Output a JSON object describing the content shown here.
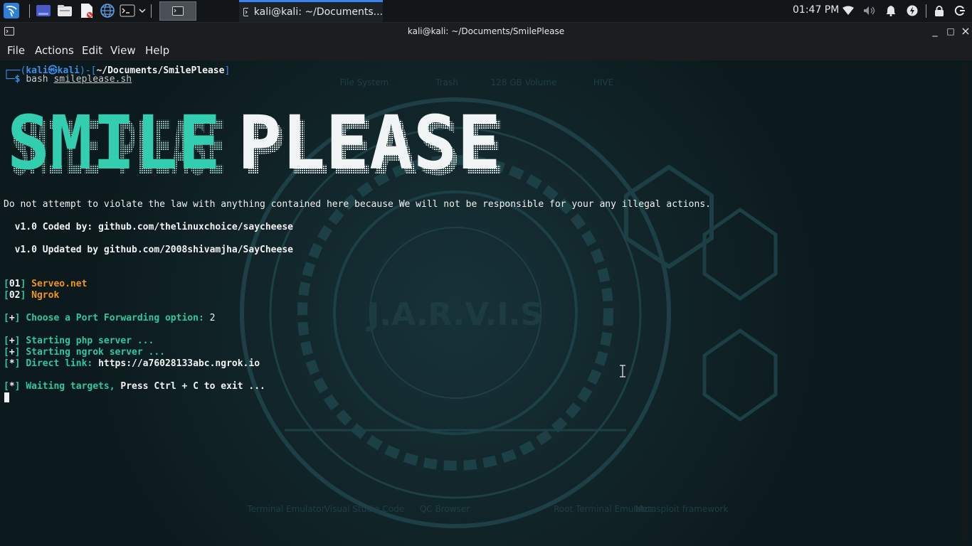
{
  "panel": {
    "clock": "01:47 PM",
    "task_title": "kali@kali: ~/Documents...",
    "launchers": [
      "show-desktop-icon",
      "file-manager-icon",
      "text-editor-icon",
      "web-browser-icon",
      "terminal-icon"
    ]
  },
  "window": {
    "title": "kali@kali: ~/Documents/SmilePlease",
    "controls": {
      "minimize": "_",
      "maximize": "□",
      "close": "×"
    }
  },
  "menubar": {
    "items": [
      "File",
      "Actions",
      "Edit",
      "View",
      "Help"
    ]
  },
  "terminal": {
    "prompt": {
      "user": "kali",
      "host": "kali",
      "at": "㉿",
      "cwd": "~/Documents/SmilePlease",
      "command": "bash",
      "argument": "smileplease.sh"
    },
    "banner_text": "SMILE PLEASE",
    "disclaimer": "Do not attempt to violate the law with anything contained here because We will not be responsible for your any illegal actions.",
    "coded_by": "  v1.0 Coded by: github.com/thelinuxchoice/saycheese",
    "updated_by": "  v1.0 Updated by github.com/2008shivamjha/SayCheese",
    "options": [
      {
        "num": "01",
        "label": "Serveo.net"
      },
      {
        "num": "02",
        "label": "Ngrok"
      }
    ],
    "choose_prompt": "Choose a Port Forwarding option:",
    "choose_value": "2",
    "starting_php": "Starting php server ...",
    "starting_ngrok": "Starting ngrok server ...",
    "direct_link_label": "Direct link:",
    "direct_link": "https://a76028133abc.ngrok.io",
    "waiting_a": "Waiting targets,",
    "waiting_b": "Press Ctrl + C to exit ...",
    "plus": "+",
    "star": "*"
  },
  "background": {
    "wallpaper_text": "J.A.R.V.I.S",
    "desktop_icons": [
      "File System",
      "Trash",
      "128 GB Volume",
      "HIVE",
      "Terminal Emulator",
      "Visual Studio Code",
      "QC Browser",
      "Root Terminal Emulator",
      "Metasploit framework"
    ]
  },
  "colors": {
    "terminal_bg": "#0f1e22",
    "prompt_blue": "#3b8eea",
    "accent_green": "#2ec8a0",
    "option_orange": "#f0941f",
    "tab_underline": "#3b82f6"
  }
}
